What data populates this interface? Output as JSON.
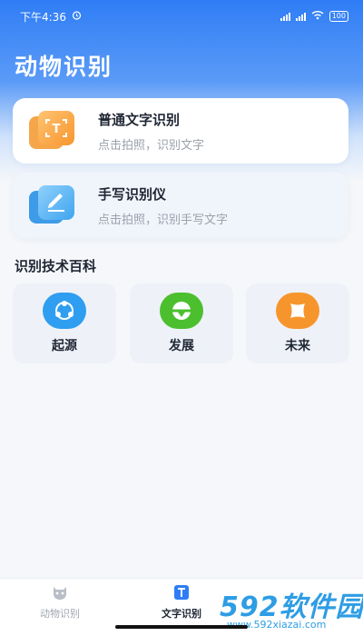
{
  "status_bar": {
    "time": "下午4:36",
    "alarm_icon": "alarm-icon",
    "battery": "100"
  },
  "header": {
    "title": "动物识别"
  },
  "cards": [
    {
      "title": "普通文字识别",
      "subtitle": "点击拍照，识别文字",
      "icon": "text-scan-icon",
      "icon_glyph": "T",
      "color": "#f7962f"
    },
    {
      "title": "手写识别仪",
      "subtitle": "点击拍照，识别手写文字",
      "icon": "pen-write-icon",
      "color": "#3fa5ef"
    }
  ],
  "section": {
    "title": "识别技术百科"
  },
  "tiles": [
    {
      "label": "起源",
      "icon": "network-icon",
      "color": "#2f9ef0"
    },
    {
      "label": "发展",
      "icon": "globe-icon",
      "color": "#4cbf2f"
    },
    {
      "label": "未来",
      "icon": "cross-flower-icon",
      "color": "#f7952d"
    }
  ],
  "bottom_nav": {
    "items": [
      {
        "label": "动物识别",
        "icon": "animal-face-icon",
        "active": false
      },
      {
        "label": "文字识别",
        "icon": "text-doc-icon",
        "active": true
      }
    ]
  },
  "watermark": {
    "main": "592软件园",
    "url": "www.592xiazai.com"
  }
}
